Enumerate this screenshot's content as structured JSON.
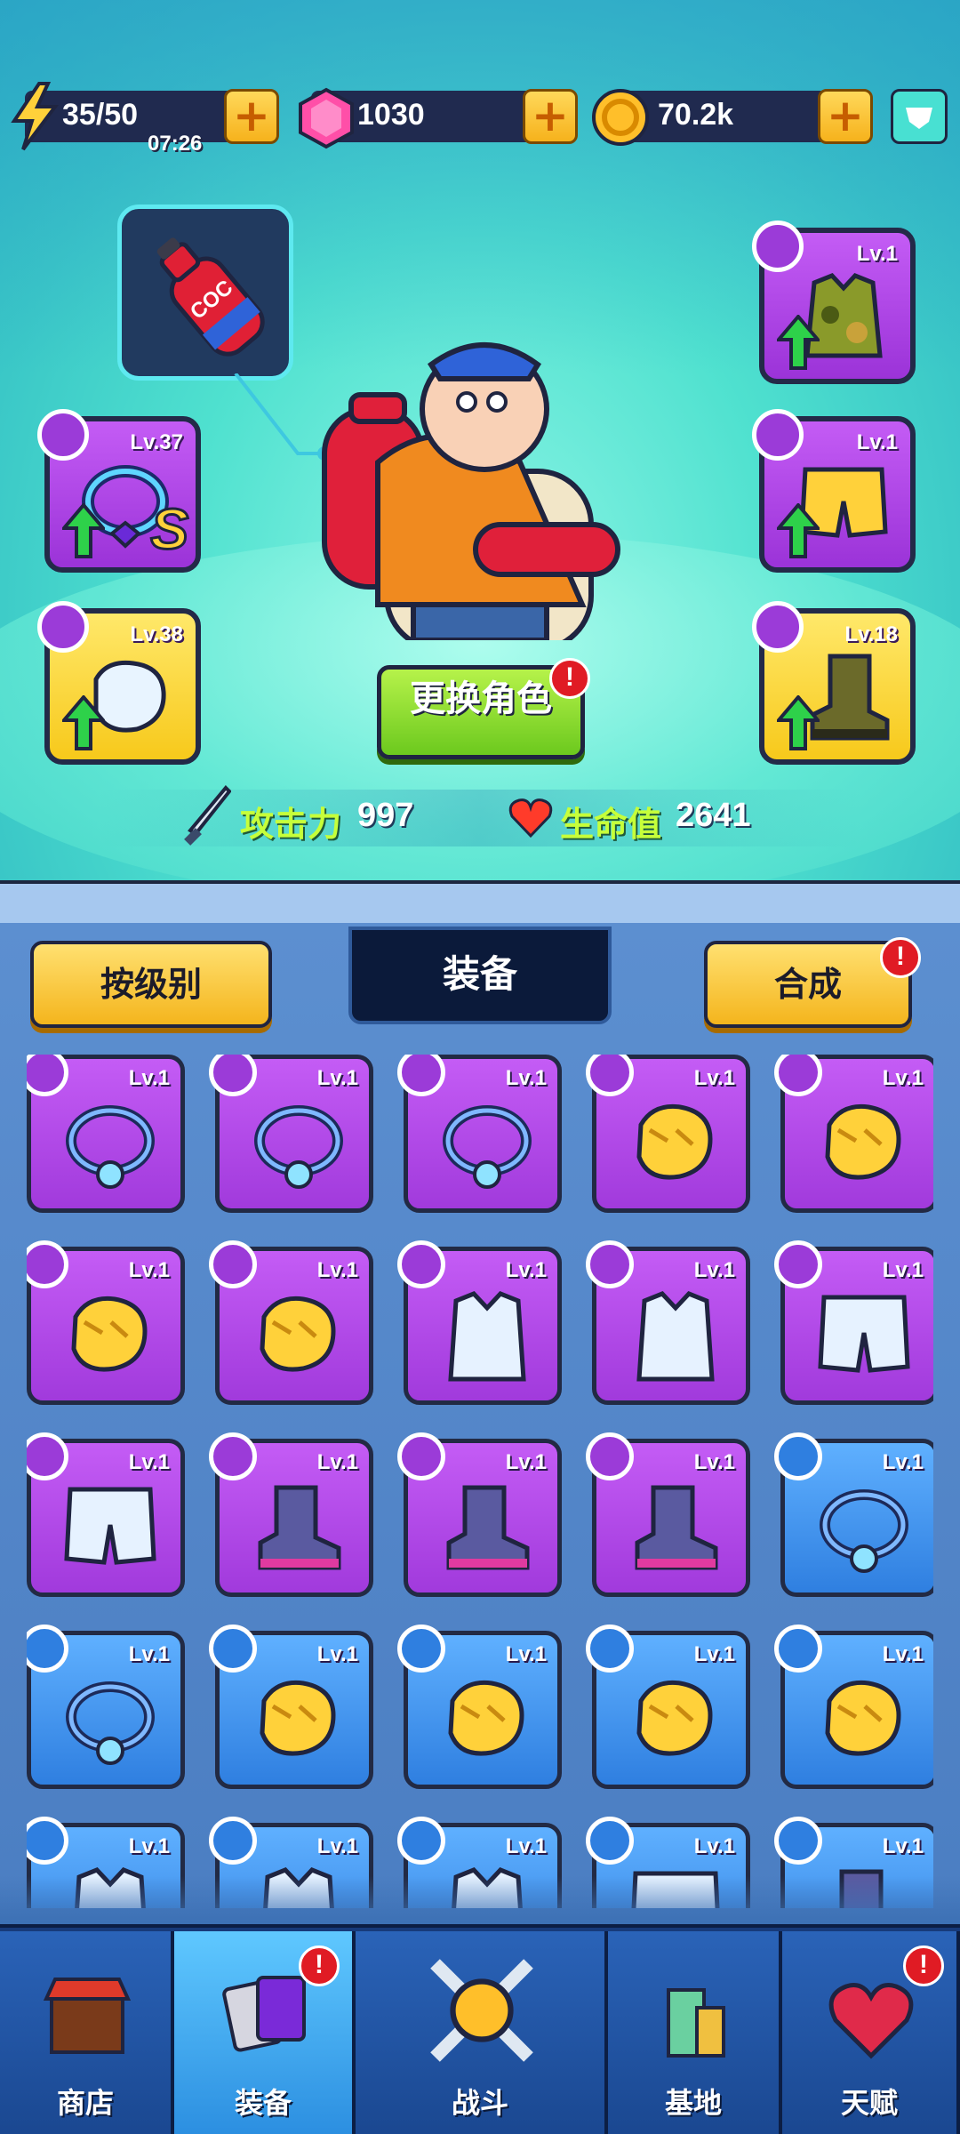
{
  "resources": {
    "energy": {
      "value": "35/50",
      "timer": "07:26"
    },
    "gems": {
      "value": "1030"
    },
    "coins": {
      "value": "70.2k"
    }
  },
  "character": {
    "bottle_label": "COC",
    "equipped": [
      {
        "slot": "necklace",
        "level": "Lv.37",
        "rarity": "purple"
      },
      {
        "slot": "gloves",
        "level": "Lv.38",
        "rarity": "yellow"
      },
      {
        "slot": "armor",
        "level": "Lv.1",
        "rarity": "purple"
      },
      {
        "slot": "pants",
        "level": "Lv.1",
        "rarity": "purple"
      },
      {
        "slot": "boots",
        "level": "Lv.18",
        "rarity": "yellow"
      }
    ],
    "change_button": "更换角色",
    "attack_label": "攻击力",
    "attack_value": "997",
    "hp_label": "生命值",
    "hp_value": "2641"
  },
  "panel": {
    "sort_button": "按级别",
    "tab_title": "装备",
    "merge_button": "合成",
    "alert_mark": "!"
  },
  "inventory": [
    {
      "type": "necklace",
      "level": "Lv.1",
      "rarity": "purple"
    },
    {
      "type": "necklace",
      "level": "Lv.1",
      "rarity": "purple"
    },
    {
      "type": "necklace",
      "level": "Lv.1",
      "rarity": "purple"
    },
    {
      "type": "gloves",
      "level": "Lv.1",
      "rarity": "purple"
    },
    {
      "type": "gloves",
      "level": "Lv.1",
      "rarity": "purple"
    },
    {
      "type": "gloves",
      "level": "Lv.1",
      "rarity": "purple"
    },
    {
      "type": "gloves",
      "level": "Lv.1",
      "rarity": "purple"
    },
    {
      "type": "armor",
      "level": "Lv.1",
      "rarity": "purple"
    },
    {
      "type": "armor",
      "level": "Lv.1",
      "rarity": "purple"
    },
    {
      "type": "pants",
      "level": "Lv.1",
      "rarity": "purple"
    },
    {
      "type": "pants",
      "level": "Lv.1",
      "rarity": "purple"
    },
    {
      "type": "boots",
      "level": "Lv.1",
      "rarity": "purple"
    },
    {
      "type": "boots",
      "level": "Lv.1",
      "rarity": "purple"
    },
    {
      "type": "boots",
      "level": "Lv.1",
      "rarity": "purple"
    },
    {
      "type": "necklace",
      "level": "Lv.1",
      "rarity": "blue"
    },
    {
      "type": "necklace",
      "level": "Lv.1",
      "rarity": "blue"
    },
    {
      "type": "gloves",
      "level": "Lv.1",
      "rarity": "blue"
    },
    {
      "type": "gloves",
      "level": "Lv.1",
      "rarity": "blue"
    },
    {
      "type": "gloves",
      "level": "Lv.1",
      "rarity": "blue"
    },
    {
      "type": "gloves",
      "level": "Lv.1",
      "rarity": "blue"
    },
    {
      "type": "armor",
      "level": "Lv.1",
      "rarity": "blue"
    },
    {
      "type": "armor",
      "level": "Lv.1",
      "rarity": "blue"
    },
    {
      "type": "armor",
      "level": "Lv.1",
      "rarity": "blue"
    },
    {
      "type": "pants",
      "level": "Lv.1",
      "rarity": "blue"
    },
    {
      "type": "boots",
      "level": "Lv.1",
      "rarity": "blue"
    }
  ],
  "nav": [
    {
      "label": "商店",
      "icon": "shop-icon",
      "active": false,
      "alert": false
    },
    {
      "label": "装备",
      "icon": "cards-icon",
      "active": true,
      "alert": true
    },
    {
      "label": "战斗",
      "icon": "crossed-swords-icon",
      "active": false,
      "alert": false
    },
    {
      "label": "基地",
      "icon": "building-icon",
      "active": false,
      "alert": false
    },
    {
      "label": "天赋",
      "icon": "heart-shield-icon",
      "active": false,
      "alert": true
    }
  ],
  "colors": {
    "rarity_purple": "#b04ae8",
    "rarity_yellow": "#f7c91b",
    "rarity_blue": "#3f92f0",
    "accent_yellow": "#f6b21c",
    "stat_green": "#c6ff3a"
  }
}
